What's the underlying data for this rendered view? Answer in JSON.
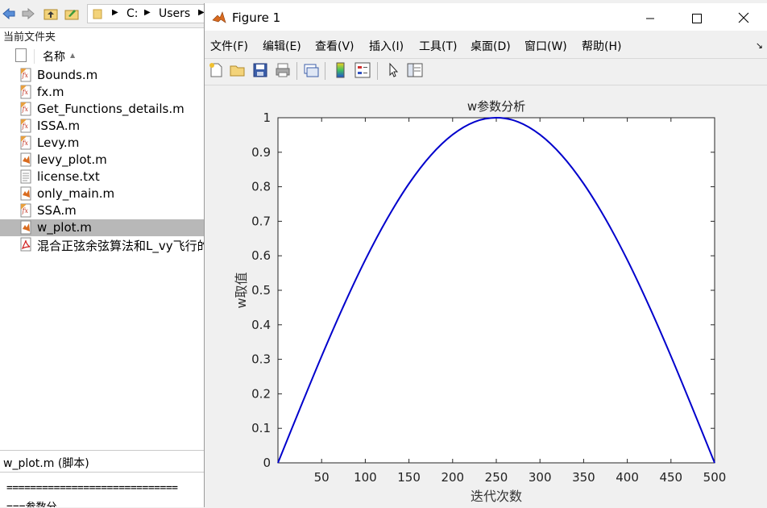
{
  "address_bar": {
    "crumbs": [
      "C:",
      "Users"
    ]
  },
  "file_browser": {
    "current_folder_label": "当前文件夹",
    "column_header": "名称",
    "files": [
      {
        "name": "Bounds.m",
        "icon": "function-file-icon",
        "selected": false
      },
      {
        "name": "fx.m",
        "icon": "function-file-icon",
        "selected": false
      },
      {
        "name": "Get_Functions_details.m",
        "icon": "function-file-icon",
        "selected": false
      },
      {
        "name": "ISSA.m",
        "icon": "function-file-icon",
        "selected": false
      },
      {
        "name": "Levy.m",
        "icon": "function-file-icon",
        "selected": false
      },
      {
        "name": "levy_plot.m",
        "icon": "script-file-icon",
        "selected": false
      },
      {
        "name": "license.txt",
        "icon": "text-file-icon",
        "selected": false
      },
      {
        "name": "only_main.m",
        "icon": "script-file-icon",
        "selected": false
      },
      {
        "name": "SSA.m",
        "icon": "function-file-icon",
        "selected": false
      },
      {
        "name": "w_plot.m",
        "icon": "script-file-icon",
        "selected": true
      },
      {
        "name": "混合正弦余弦算法和L_vy飞行的",
        "icon": "pdf-file-icon",
        "selected": false
      }
    ],
    "detail_title": "w_plot.m  (脚本)",
    "preview_line1": "=============================",
    "preview_line2": "===参数分"
  },
  "figure_window": {
    "title": "Figure 1",
    "menus": [
      "文件(F)",
      "编辑(E)",
      "查看(V)",
      "插入(I)",
      "工具(T)",
      "桌面(D)",
      "窗口(W)",
      "帮助(H)"
    ],
    "menu_arrow": "↘",
    "toolbar_icons": [
      "new-figure-icon",
      "open-file-icon",
      "save-icon",
      "print-icon",
      "link-plot-icon",
      "insert-colorbar-icon",
      "insert-legend-icon",
      "pointer-icon",
      "property-inspector-icon"
    ]
  },
  "chart_data": {
    "type": "line",
    "title": "w参数分析",
    "xlabel": "迭代次数",
    "ylabel": "w取值",
    "xlim": [
      0,
      500
    ],
    "ylim": [
      0,
      1
    ],
    "xticks": [
      50,
      100,
      150,
      200,
      250,
      300,
      350,
      400,
      450,
      500
    ],
    "yticks": [
      0,
      0.1,
      0.2,
      0.3,
      0.4,
      0.5,
      0.6,
      0.7,
      0.8,
      0.9,
      1
    ],
    "ytick_labels": [
      "0",
      "0.1",
      "0.2",
      "0.3",
      "0.4",
      "0.5",
      "0.6",
      "0.7",
      "0.8",
      "0.9",
      "1"
    ],
    "grid": false,
    "series": [
      {
        "color": "#0000cc",
        "x": [
          0,
          25,
          50,
          75,
          100,
          125,
          150,
          175,
          200,
          225,
          250,
          275,
          300,
          325,
          350,
          375,
          400,
          425,
          450,
          475,
          500
        ],
        "y": [
          0,
          0.156,
          0.309,
          0.454,
          0.588,
          0.707,
          0.809,
          0.891,
          0.951,
          0.988,
          1,
          0.988,
          0.951,
          0.891,
          0.809,
          0.707,
          0.588,
          0.454,
          0.309,
          0.156,
          0
        ]
      }
    ]
  }
}
